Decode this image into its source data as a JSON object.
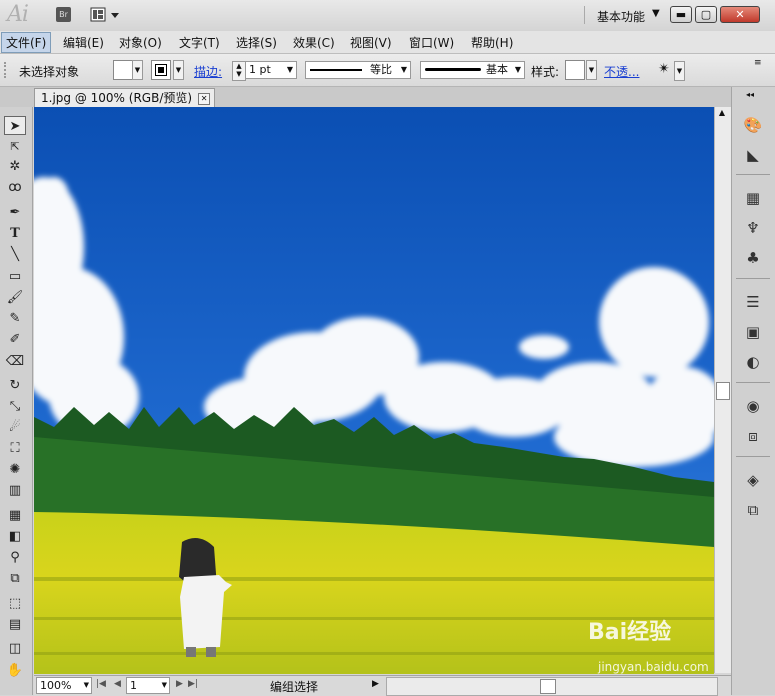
{
  "app": {
    "logo_text": "Ai",
    "bridge_label": "Br",
    "workspace_label": "基本功能",
    "workspace_arrow": "▼"
  },
  "window_buttons": {
    "minimize": "▬",
    "maximize": "▢",
    "close": "✕"
  },
  "menu": [
    "文件(F)",
    "编辑(E)",
    "对象(O)",
    "文字(T)",
    "选择(S)",
    "效果(C)",
    "视图(V)",
    "窗口(W)",
    "帮助(H)"
  ],
  "control_bar": {
    "selection_status": "未选择对象",
    "stroke_link": "描边:",
    "stroke_weight": "1 pt",
    "stroke_profile_label": "等比",
    "brush_label": "基本",
    "style_label": "样式:",
    "opacity_link": "不透..."
  },
  "document": {
    "tab_title": "1.jpg @ 100% (RGB/预览)",
    "tab_close": "✕"
  },
  "status_bar": {
    "zoom": "100%",
    "page": "1",
    "status_text": "编组选择"
  },
  "watermark": {
    "brand": "Bai经验",
    "url": "jingyan.baidu.com"
  },
  "tools": [
    "selection-tool",
    "direct-selection-tool",
    "magic-wand-tool",
    "lasso-tool",
    "pen-tool",
    "type-tool",
    "line-tool",
    "rectangle-tool",
    "paintbrush-tool",
    "pencil-tool",
    "blob-brush-tool",
    "eraser-tool",
    "rotate-tool",
    "scale-tool",
    "warp-tool",
    "free-transform-tool",
    "symbol-sprayer-tool",
    "column-graph-tool",
    "mesh-tool",
    "gradient-tool",
    "eyedropper-tool",
    "blend-tool",
    "live-paint-tool",
    "artboard-tool",
    "slice-tool",
    "hand-tool"
  ],
  "panels": [
    "color-panel",
    "color-guide-panel",
    "swatches-panel",
    "brushes-panel",
    "symbols-panel",
    "stroke-panel",
    "gradient-panel",
    "transparency-panel",
    "appearance-panel",
    "graphic-styles-panel",
    "layers-panel",
    "artboards-panel"
  ]
}
